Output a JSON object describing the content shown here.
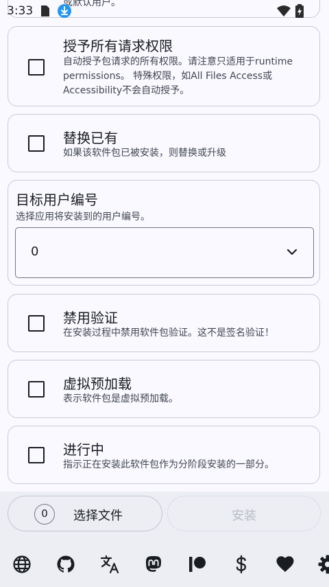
{
  "status_bar": {
    "time": "3:33",
    "icons": [
      "sim-card-icon",
      "download-icon",
      "wifi-icon",
      "battery-icon"
    ]
  },
  "partial_card": {
    "text": "或默认用户。"
  },
  "options": [
    {
      "title": "授予所有请求权限",
      "description": "自动授予包请求的所有权限。请注意只适用于runtime permissions。 特殊权限，如All Files Access或Accessibility不会自动授予。",
      "checked": false
    },
    {
      "title": "替换已有",
      "description": "如果该软件包已被安装，则替换或升级",
      "checked": false
    }
  ],
  "target_user": {
    "title": "目标用户编号",
    "description": "选择应用将安装到的用户编号。",
    "selected_value": "0"
  },
  "options_lower": [
    {
      "title": "禁用验证",
      "description": "在安装过程中禁用软件包验证。这不是签名验证！",
      "checked": false
    },
    {
      "title": "虚拟预加载",
      "description": "表示软件包是虚拟预加载。",
      "checked": false
    },
    {
      "title": "进行中",
      "description": "指示正在安装此软件包作为分阶段安装的一部分。",
      "checked": false
    }
  ],
  "actions": {
    "selected_count": "0",
    "select_file_label": "选择文件",
    "install_label": "安装",
    "install_enabled": false
  },
  "bottom_nav": {
    "icons": [
      "globe-icon",
      "github-icon",
      "translate-icon",
      "mastodon-icon",
      "patreon-icon",
      "dollar-icon",
      "heart-icon",
      "settings-icon"
    ]
  },
  "colors": {
    "background": "#f9f9ff",
    "card_border": "#c8ccd5",
    "text_primary": "#191c20",
    "text_secondary": "#43474e",
    "bar_background": "#eceef4",
    "download_badge": "#2196f3",
    "disabled_text": "#b8bcc4"
  }
}
